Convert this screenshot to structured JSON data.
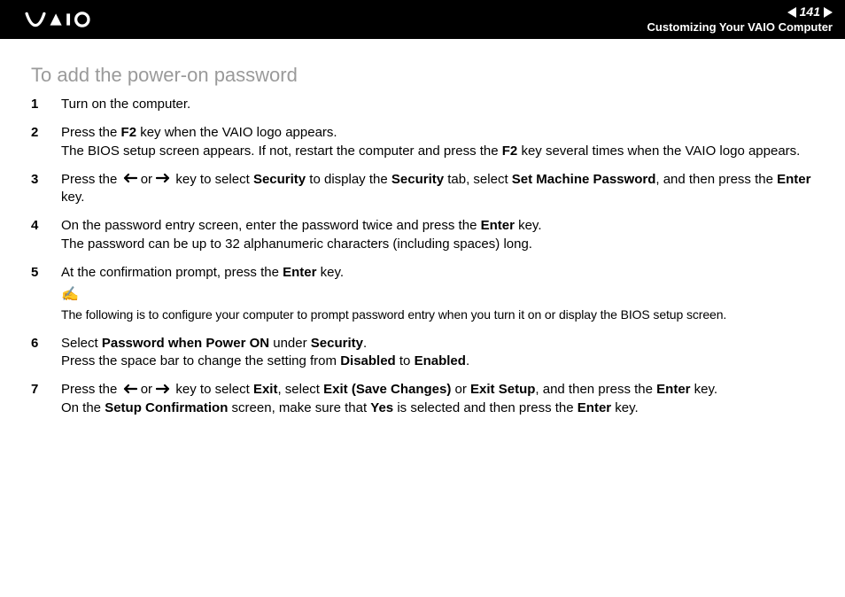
{
  "header": {
    "page_number": "141",
    "section": "Customizing Your VAIO Computer"
  },
  "heading": "To add the power-on password",
  "steps": {
    "s1": "Turn on the computer.",
    "s2a": "Press the ",
    "s2b": " key when the VAIO logo appears.",
    "s2c": "The BIOS setup screen appears. If not, restart the computer and press the ",
    "s2d": " key several times when the VAIO logo appears.",
    "s2_f2": "F2",
    "s3a": "Press the ",
    "s3_or": " or ",
    "s3b": " key to select ",
    "s3_sec": "Security",
    "s3c": " to display the ",
    "s3d": " tab, select ",
    "s3_smp": "Set Machine Password",
    "s3e": ", and then press the ",
    "s3_enter": "Enter",
    "s3f": " key.",
    "s4a": "On the password entry screen, enter the password twice and press the ",
    "s4b": " key.",
    "s4c": "The password can be up to 32 alphanumeric characters (including spaces) long.",
    "s5a": "At the confirmation prompt, press the ",
    "s5b": " key.",
    "note": "The following is to configure your computer to prompt password entry when you turn it on or display the BIOS setup screen.",
    "s6a": "Select ",
    "s6_pwpo": "Password when Power ON",
    "s6b": " under ",
    "s6c": ".",
    "s6d": "Press the space bar to change the setting from ",
    "s6_dis": "Disabled",
    "s6e": " to ",
    "s6_en": "Enabled",
    "s6f": ".",
    "s7a": "Press the ",
    "s7b": " key to select ",
    "s7_exit": "Exit",
    "s7c": ", select ",
    "s7_esc": "Exit (Save Changes)",
    "s7d": " or ",
    "s7_es": "Exit Setup",
    "s7e": ", and then press the ",
    "s7f": " key.",
    "s7g": "On the ",
    "s7_sc": "Setup Confirmation",
    "s7h": " screen, make sure that ",
    "s7_yes": "Yes",
    "s7i": " is selected and then press the ",
    "s7j": " key."
  }
}
